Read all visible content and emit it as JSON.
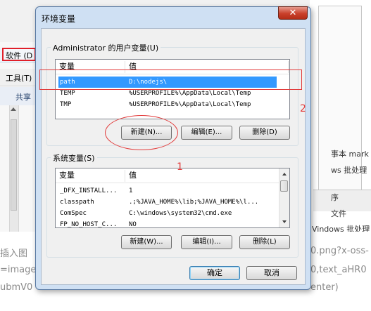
{
  "background": {
    "menu_item": "软件 (D",
    "tools_menu": "工具(T)",
    "share_button": "共享",
    "right_panel_lines": [
      "事本 mark",
      "ws 批处理",
      "序",
      "文件",
      "Vindows 批处理"
    ],
    "bottom_lines": [
      {
        "left": "插入图",
        "right": "0.png?x-oss-"
      },
      {
        "left": "=image",
        "right": "0,text_aHR0"
      },
      {
        "left": "ubmV0",
        "right": "enter)"
      }
    ]
  },
  "dialog": {
    "title": "环境变量",
    "close_glyph": "✕",
    "user_group": {
      "label": "Administrator 的用户变量(U)",
      "columns": [
        "变量",
        "值"
      ],
      "rows": [
        {
          "name": "path",
          "value": "D:\\nodejs\\",
          "selected": true
        },
        {
          "name": "TEMP",
          "value": "%USERPROFILE%\\AppData\\Local\\Temp",
          "selected": false
        },
        {
          "name": "TMP",
          "value": "%USERPROFILE%\\AppData\\Local\\Temp",
          "selected": false
        }
      ],
      "buttons": {
        "new": "新建(N)...",
        "edit": "编辑(E)...",
        "delete": "删除(D)"
      }
    },
    "system_group": {
      "label": "系统变量(S)",
      "columns": [
        "变量",
        "值"
      ],
      "rows": [
        {
          "name": "_DFX_INSTALL...",
          "value": "1"
        },
        {
          "name": "classpath",
          "value": ".;%JAVA_HOME%\\lib;%JAVA_HOME%\\l..."
        },
        {
          "name": "ComSpec",
          "value": "C:\\windows\\system32\\cmd.exe"
        },
        {
          "name": "FP_NO_HOST_C...",
          "value": "NO"
        }
      ],
      "buttons": {
        "new": "新建(W)...",
        "edit": "编辑(I)...",
        "delete": "删除(L)"
      }
    },
    "ok_button": "确定",
    "cancel_button": "取消"
  },
  "annotations": {
    "label_1": "1",
    "label_2": "2"
  },
  "colors": {
    "selection": "#3399ff",
    "annotation": "#e23b3b",
    "title_bar": "#cfe0f3"
  }
}
